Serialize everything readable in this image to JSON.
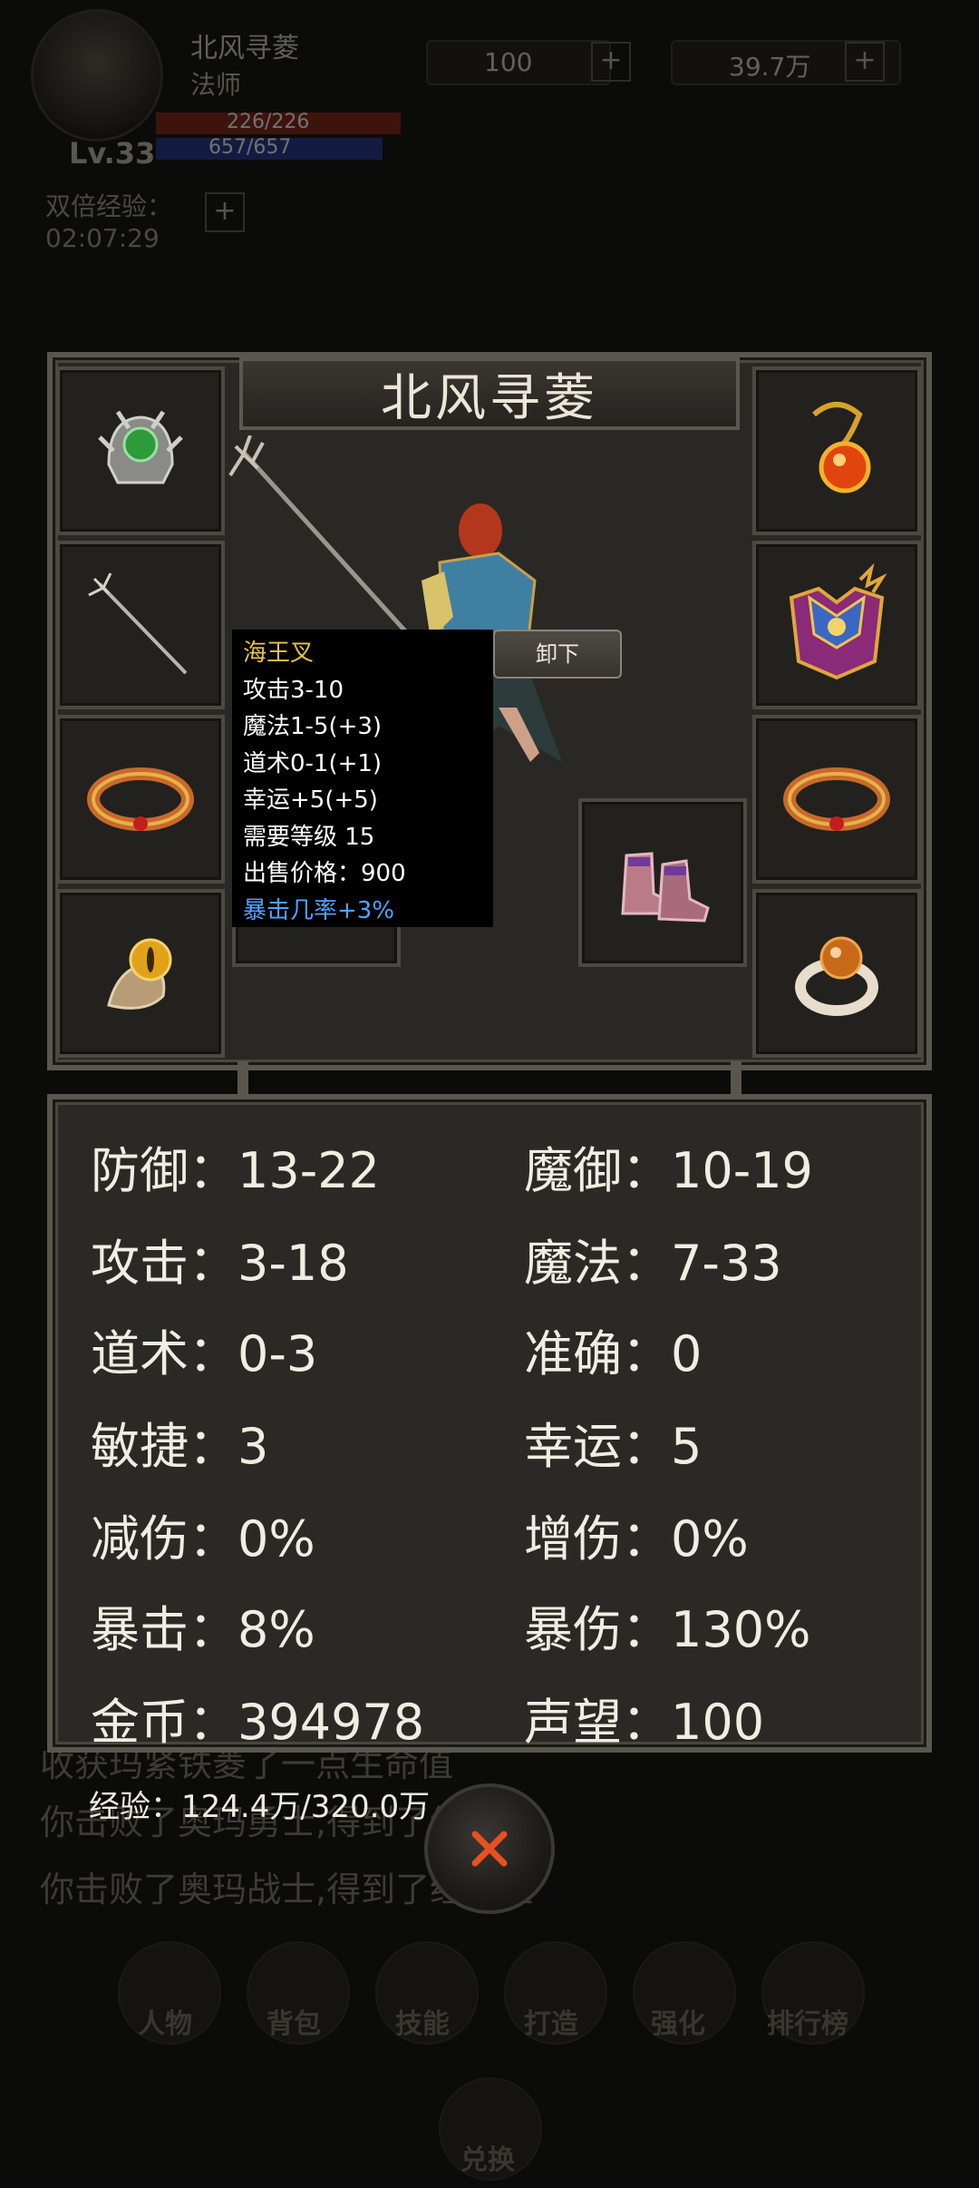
{
  "hud": {
    "player_name": "北风寻菱",
    "player_class": "法师",
    "hp_text": "226/226",
    "mp_text": "657/657",
    "level": "Lv.33",
    "resource1": "100",
    "resource2": "39.7万",
    "plus": "+",
    "double_exp_label": "双倍经验：",
    "double_exp_timer": "02:07:29"
  },
  "log": [
    "收获玛紧铁菱了一点生命值",
    "你击败了奥玛勇士,得到了经验值",
    "你击败了奥玛战士,得到了经验值"
  ],
  "nav": [
    "人物",
    "背包",
    "技能",
    "打造",
    "强化",
    "排行榜"
  ],
  "nav_center": "兑换",
  "panel": {
    "title": "北风寻菱",
    "unequip_label": "卸下"
  },
  "tooltip": {
    "name": "海王叉",
    "lines": [
      "攻击3-10",
      "魔法1-5(+3)",
      "道术0-1(+1)",
      "幸运+5(+5)",
      "需要等级 15",
      "出售价格：900"
    ],
    "special": "暴击几率+3%"
  },
  "stats": [
    {
      "label": "防御：",
      "value": "13-22"
    },
    {
      "label": "魔御：",
      "value": "10-19"
    },
    {
      "label": "攻击：",
      "value": "3-18"
    },
    {
      "label": "魔法：",
      "value": "7-33"
    },
    {
      "label": "道术：",
      "value": "0-3"
    },
    {
      "label": "准确：",
      "value": "0"
    },
    {
      "label": "敏捷：",
      "value": "3"
    },
    {
      "label": "幸运：",
      "value": "5"
    },
    {
      "label": "减伤：",
      "value": "0%"
    },
    {
      "label": "增伤：",
      "value": "0%"
    },
    {
      "label": "暴击：",
      "value": "8%"
    },
    {
      "label": "暴伤：",
      "value": "130%"
    },
    {
      "label": "金币：",
      "value": "394978"
    },
    {
      "label": "声望：",
      "value": "100"
    }
  ],
  "exp_text": "经验：124.4万/320.0万",
  "colors": {
    "tooltip_title": "#e8c542",
    "tooltip_special": "#4fa3ff",
    "close_x": "#e8501f"
  }
}
